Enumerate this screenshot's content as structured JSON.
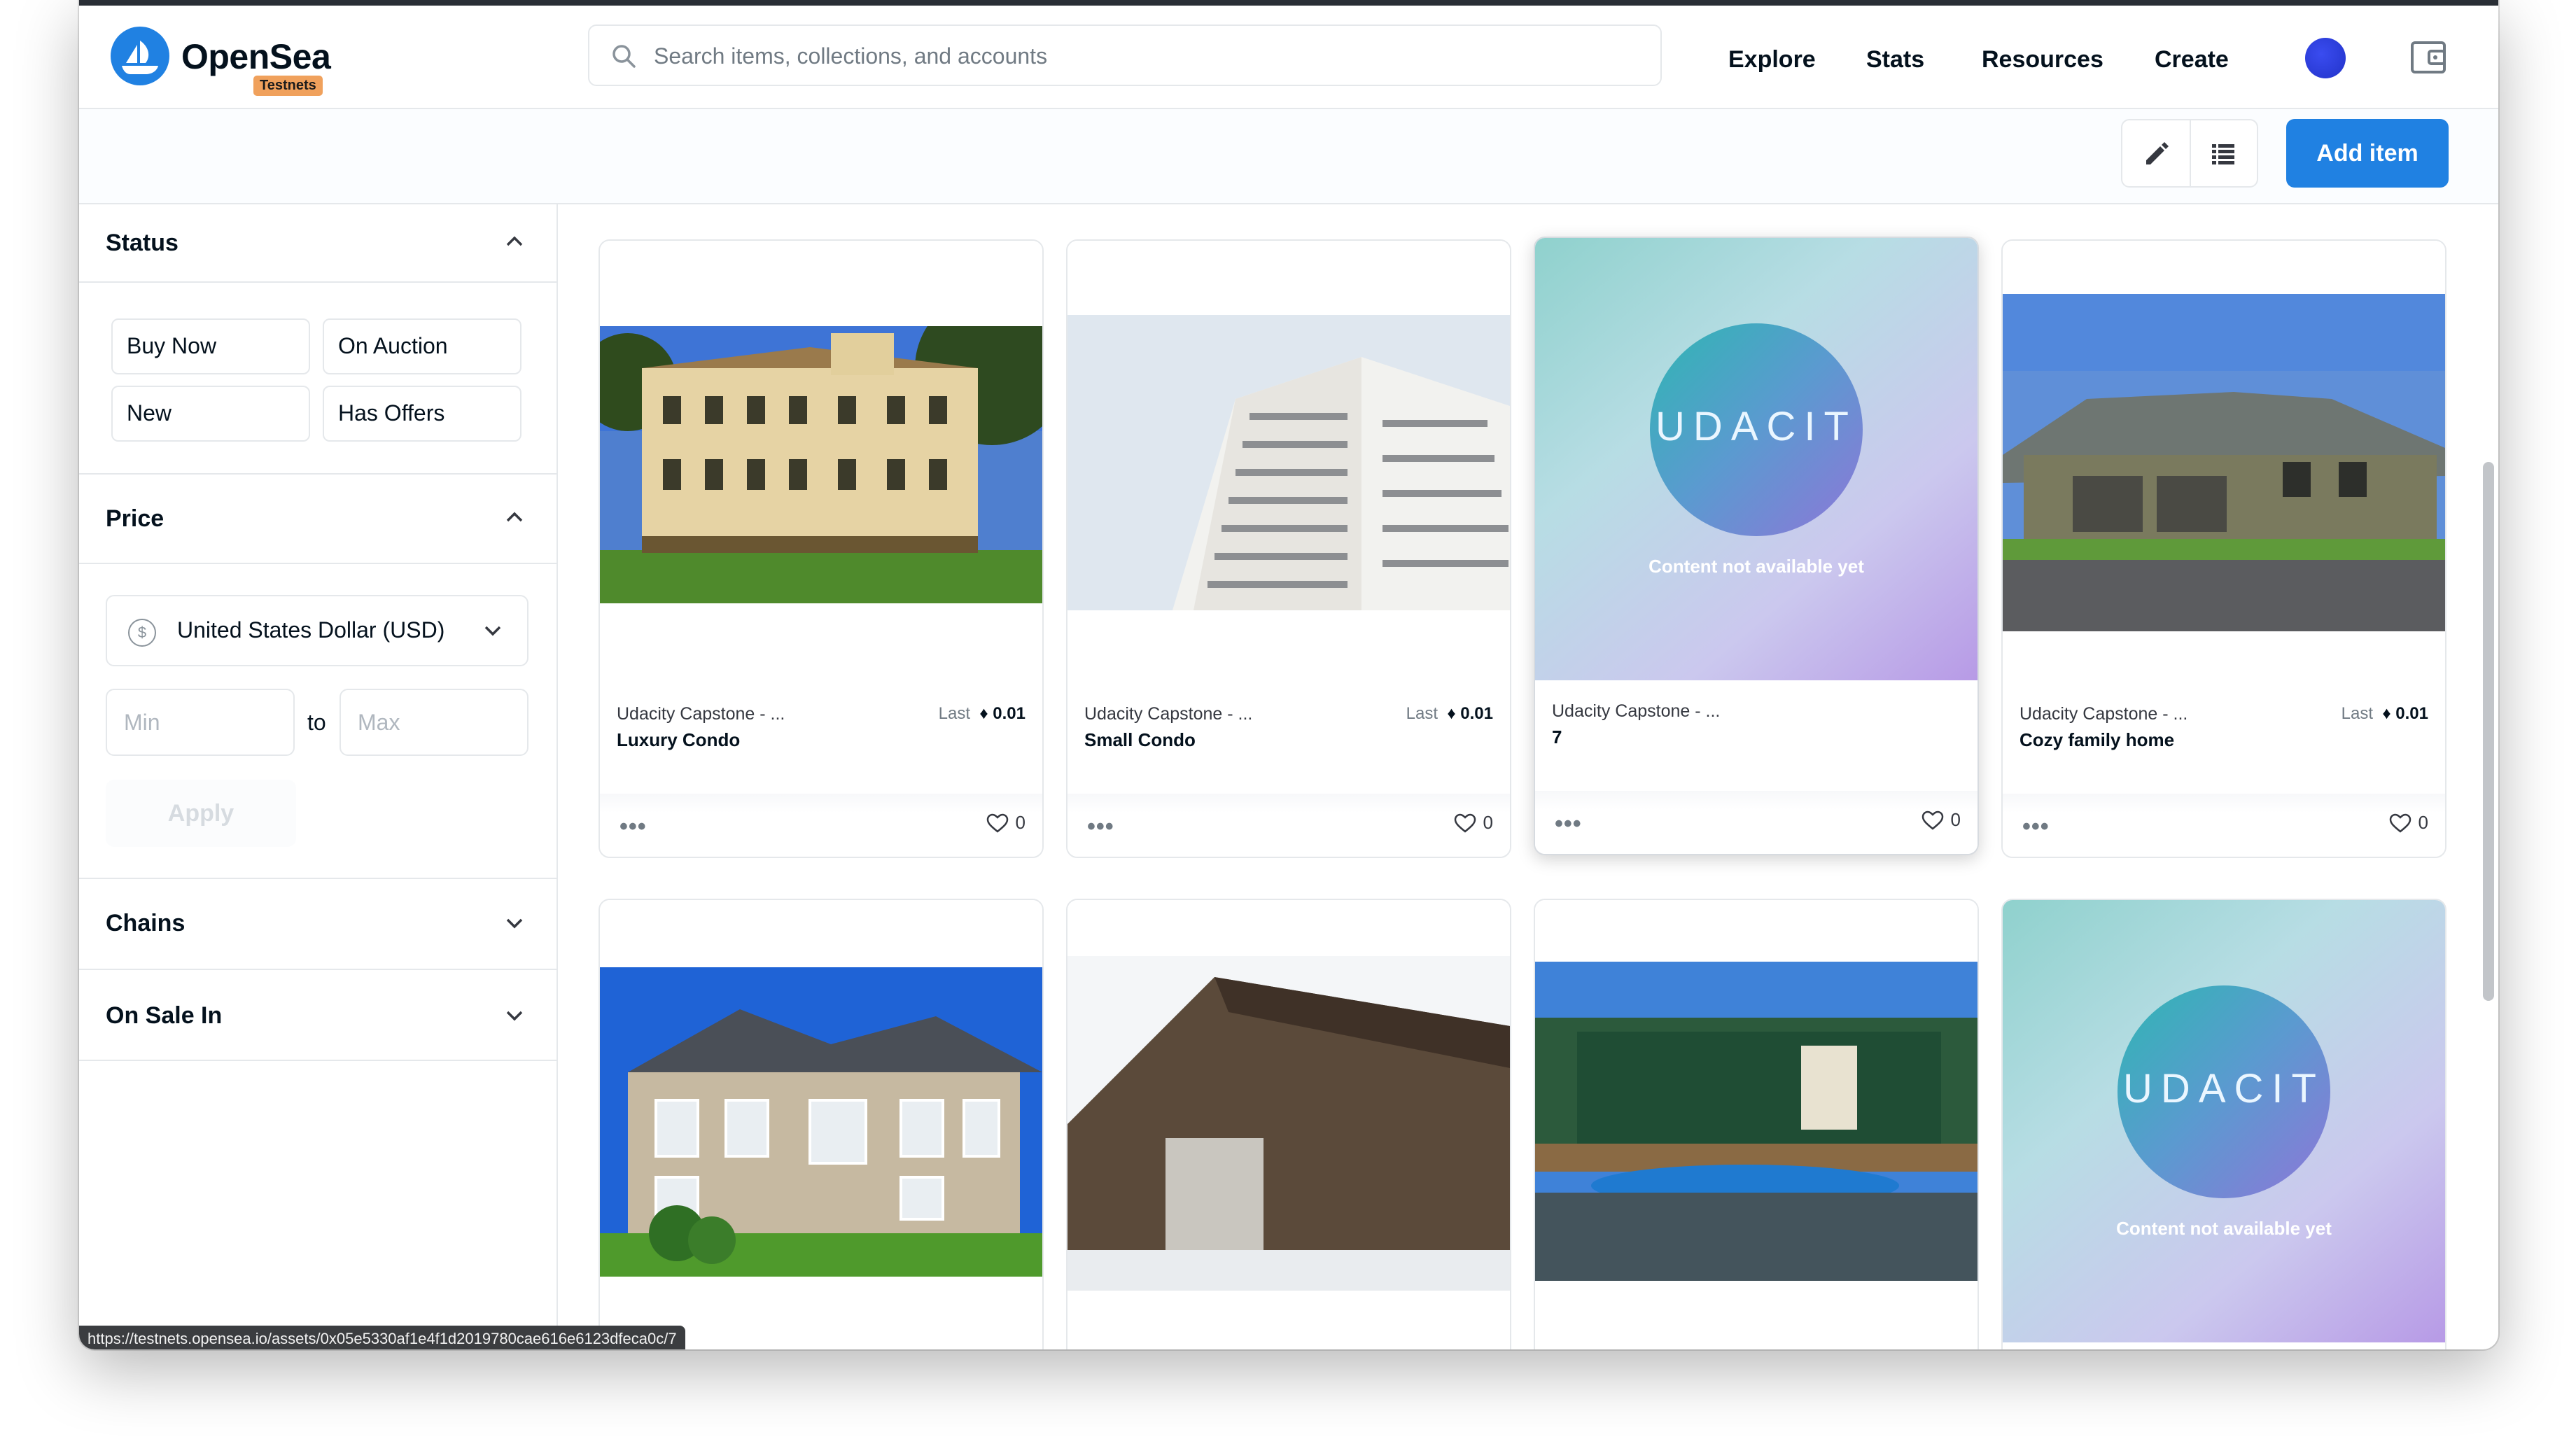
{
  "navbar": {
    "brand": "OpenSea",
    "badge": "Testnets",
    "search_placeholder": "Search items, collections, and accounts",
    "links": [
      "Explore",
      "Stats",
      "Resources",
      "Create"
    ]
  },
  "toolbar": {
    "add_item_label": "Add item"
  },
  "sidebar": {
    "status": {
      "title": "Status",
      "options": [
        "Buy Now",
        "On Auction",
        "New",
        "Has Offers"
      ]
    },
    "price": {
      "title": "Price",
      "currency_symbol": "$",
      "currency": "United States Dollar (USD)",
      "min_placeholder": "Min",
      "to_label": "to",
      "max_placeholder": "Max",
      "apply_label": "Apply"
    },
    "chains": {
      "title": "Chains"
    },
    "on_sale_in": {
      "title": "On Sale In"
    }
  },
  "cards": [
    {
      "collection": "Udacity Capstone - ...",
      "name": "Luxury Condo",
      "last_label": "Last",
      "price": "0.01",
      "likes": "0",
      "image": "luxury-condo-photo"
    },
    {
      "collection": "Udacity Capstone - ...",
      "name": "Small Condo",
      "last_label": "Last",
      "price": "0.01",
      "likes": "0",
      "image": "small-condo-photo"
    },
    {
      "collection": "Udacity Capstone - ...",
      "name": "7",
      "likes": "0",
      "image": "udacity-placeholder",
      "placeholder_logo": "UDACIT",
      "placeholder_text": "Content not available yet"
    },
    {
      "collection": "Udacity Capstone - ...",
      "name": "Cozy family home",
      "last_label": "Last",
      "price": "0.01",
      "likes": "0",
      "image": "cozy-family-home-photo"
    },
    {
      "image": "house-blue-sky-photo"
    },
    {
      "image": "barn-photo"
    },
    {
      "image": "houseboat-photo"
    },
    {
      "image": "udacity-placeholder",
      "placeholder_logo": "UDACIT",
      "placeholder_text": "Content not available yet"
    }
  ],
  "status_url": "https://testnets.opensea.io/assets/0x05e5330af1e4f1d2019780cae616e6123dfeca0c/7",
  "colors": {
    "accent": "#2081e2",
    "badge": "#f0a15c",
    "border": "#e5e8eb"
  }
}
